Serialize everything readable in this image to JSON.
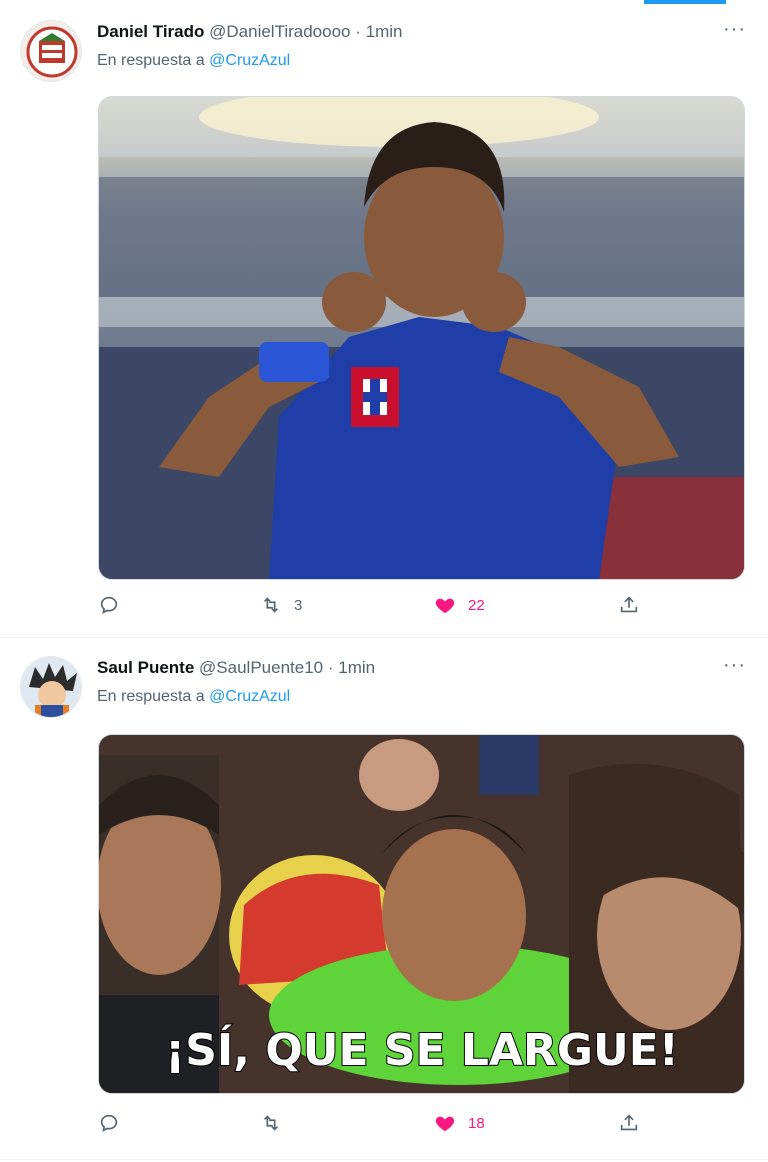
{
  "tweets": [
    {
      "name": "Daniel Tirado",
      "handle": "@DanielTiradoooo",
      "separator": "·",
      "time": "1min",
      "reply_prefix": "En respuesta a",
      "reply_to": "@CruzAzul",
      "media": "soccer player in blue Cruz Azul jersey kissing crest",
      "stats": {
        "replies": "",
        "retweets": "3",
        "likes": "22"
      }
    },
    {
      "name": "Saul Puente",
      "handle": "@SaulPuente10",
      "separator": "·",
      "time": "1min",
      "reply_prefix": "En respuesta a",
      "reply_to": "@CruzAzul",
      "media": "meme of crowd with caption",
      "media_caption": "¡SÍ, QUE SE LARGUE!",
      "stats": {
        "replies": "",
        "retweets": "",
        "likes": "18"
      }
    }
  ],
  "icons": {
    "reply": "reply-icon",
    "retweet": "retweet-icon",
    "like": "heart-icon",
    "share": "share-icon",
    "more": "more-icon"
  },
  "colors": {
    "accent": "#1d9bf0",
    "like": "#f91880",
    "muted": "#536471"
  },
  "more_label": "···"
}
